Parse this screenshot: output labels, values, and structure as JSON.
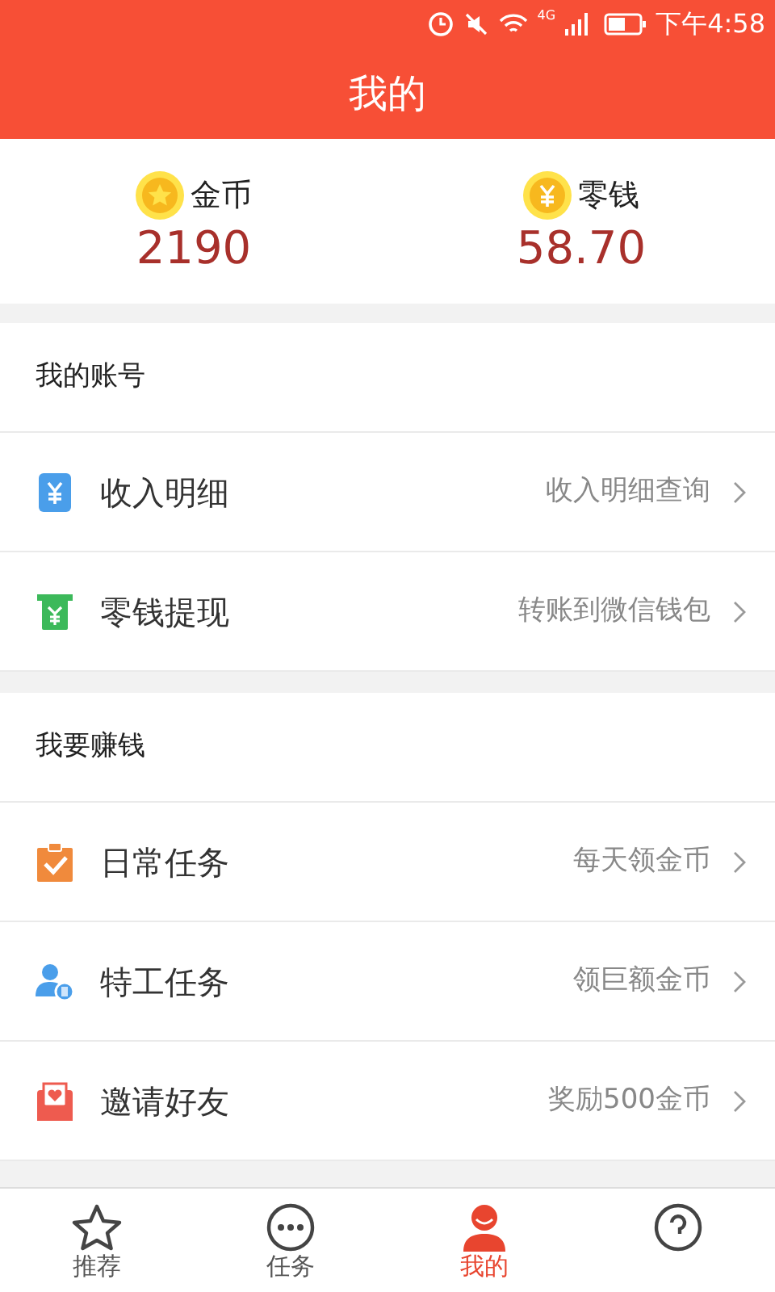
{
  "status_bar": {
    "time": "下午4:58",
    "network": "4G"
  },
  "header": {
    "title": "我的"
  },
  "balances": [
    {
      "kind": "coin",
      "label": "金币",
      "value": "2190"
    },
    {
      "kind": "cash",
      "label": "零钱",
      "value": "58.70"
    }
  ],
  "sections": [
    {
      "title": "我的账号",
      "items": [
        {
          "kind": "income",
          "label": "收入明细",
          "hint": "收入明细查询"
        },
        {
          "kind": "withdraw",
          "label": "零钱提现",
          "hint": "转账到微信钱包"
        }
      ]
    },
    {
      "title": "我要赚钱",
      "items": [
        {
          "kind": "daily",
          "label": "日常任务",
          "hint": "每天领金币"
        },
        {
          "kind": "agent",
          "label": "特工任务",
          "hint": "领巨额金币"
        },
        {
          "kind": "invite",
          "label": "邀请好友",
          "hint": "奖励500金币"
        }
      ]
    }
  ],
  "tabs": [
    {
      "kind": "star",
      "label": "推荐",
      "selected": false
    },
    {
      "kind": "dots",
      "label": "任务",
      "selected": false
    },
    {
      "kind": "person",
      "label": "我的",
      "selected": true
    },
    {
      "kind": "help",
      "selected": false
    }
  ]
}
